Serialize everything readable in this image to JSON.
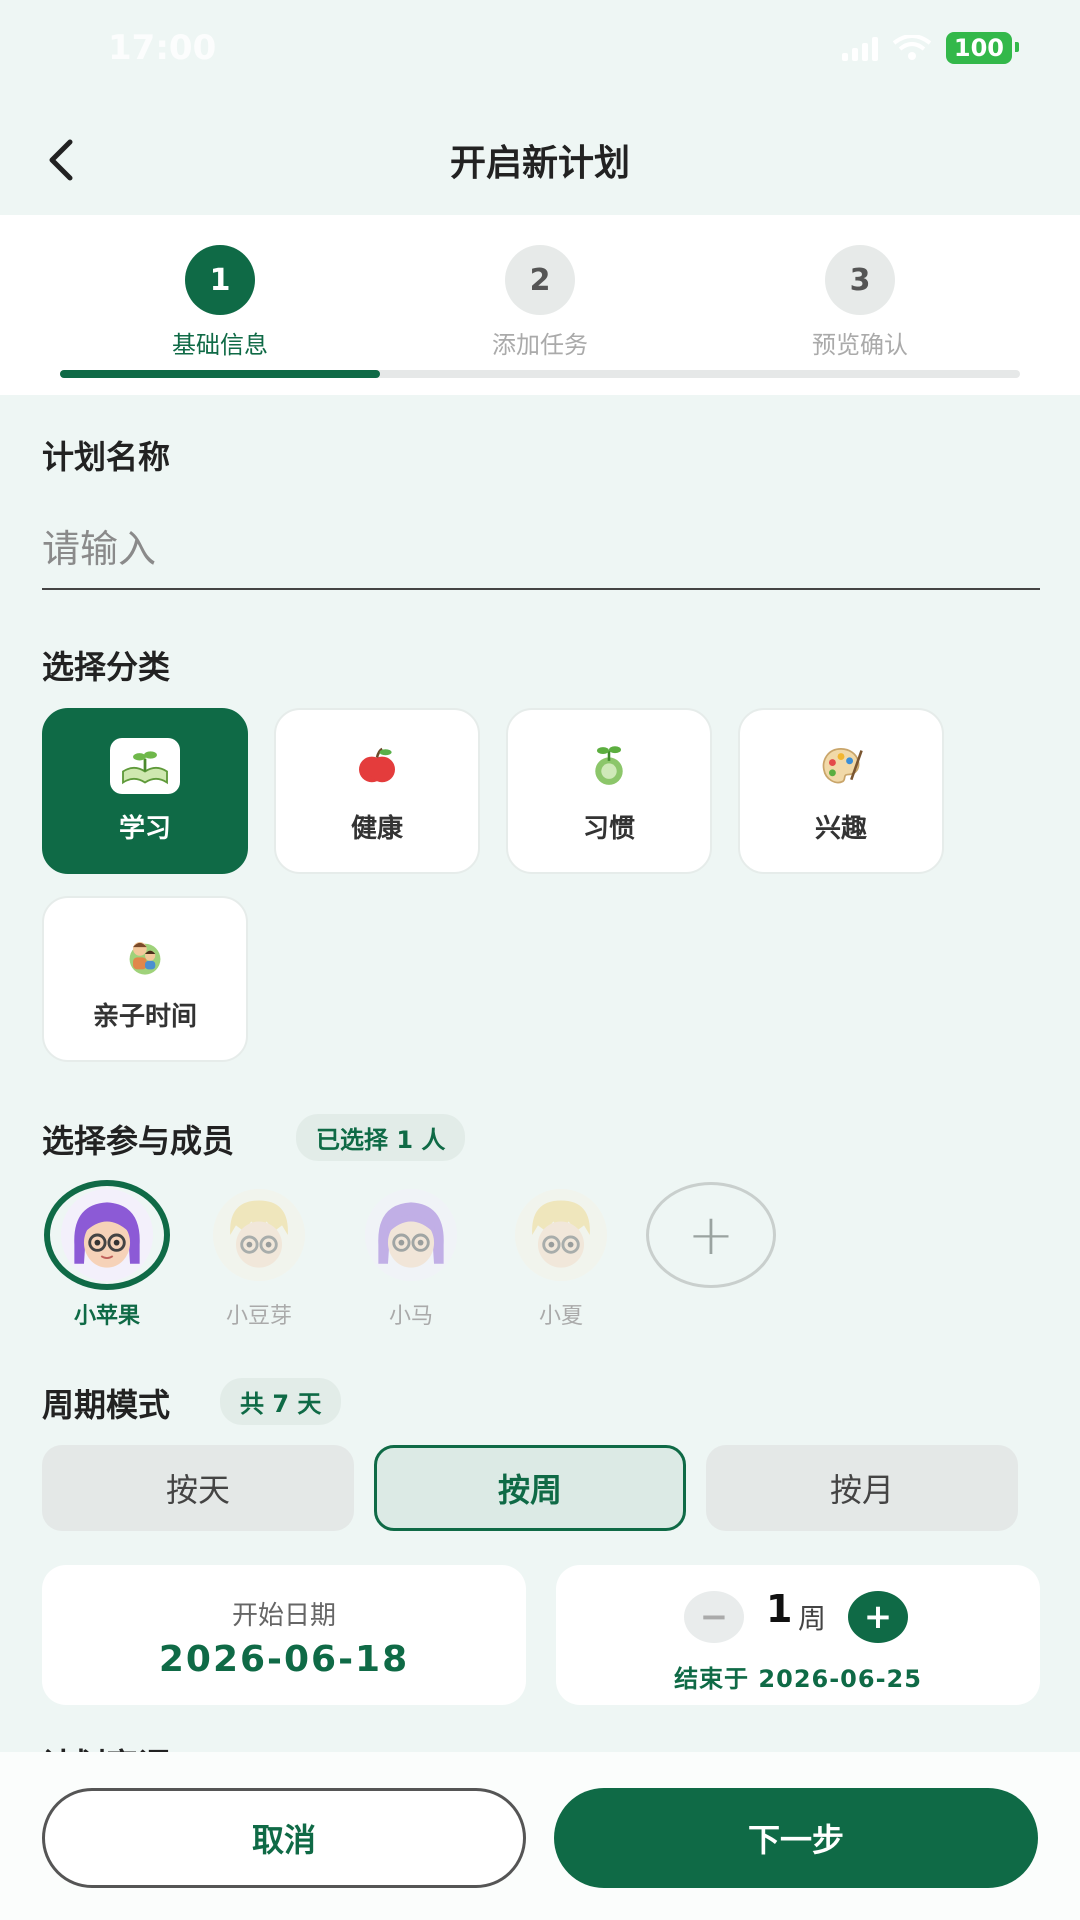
{
  "status_bar": {
    "time": "17:00",
    "battery": "100"
  },
  "header": {
    "title": "开启新计划"
  },
  "steps": [
    {
      "num": "1",
      "label": "基础信息"
    },
    {
      "num": "2",
      "label": "添加任务"
    },
    {
      "num": "3",
      "label": "预览确认"
    }
  ],
  "step_progress_fraction": 0.333,
  "plan_name": {
    "title": "计划名称",
    "placeholder": "请输入",
    "value": ""
  },
  "category": {
    "title": "选择分类",
    "items": [
      {
        "label": "学习",
        "icon": "book-sprout-icon",
        "selected": true
      },
      {
        "label": "健康",
        "icon": "apple-icon",
        "selected": false
      },
      {
        "label": "习惯",
        "icon": "habit-sprout-icon",
        "selected": false
      },
      {
        "label": "兴趣",
        "icon": "palette-icon",
        "selected": false
      },
      {
        "label": "亲子时间",
        "icon": "parent-child-icon",
        "selected": false
      }
    ]
  },
  "members": {
    "title": "选择参与成员",
    "badge": "已选择 1 人",
    "items": [
      {
        "name": "小苹果",
        "selected": true
      },
      {
        "name": "小豆芽",
        "selected": false
      },
      {
        "name": "小马",
        "selected": false
      },
      {
        "name": "小夏",
        "selected": false
      }
    ],
    "add_symbol": "+"
  },
  "period": {
    "title": "周期模式",
    "badge": "共 7 天",
    "modes": [
      "按天",
      "按周",
      "按月"
    ],
    "active_mode": "按周"
  },
  "dates": {
    "start_label": "开始日期",
    "start_value": "2026-06-18",
    "minus_symbol": "−",
    "plus_symbol": "+",
    "count": "1",
    "unit": "周",
    "end_text": "结束于 2026-06-25"
  },
  "next_section_title": "计划宣语",
  "footer": {
    "cancel": "取消",
    "next": "下一步"
  },
  "colors": {
    "primary": "#0f6a46",
    "background": "#eef6f4",
    "battery": "#33b84a"
  }
}
